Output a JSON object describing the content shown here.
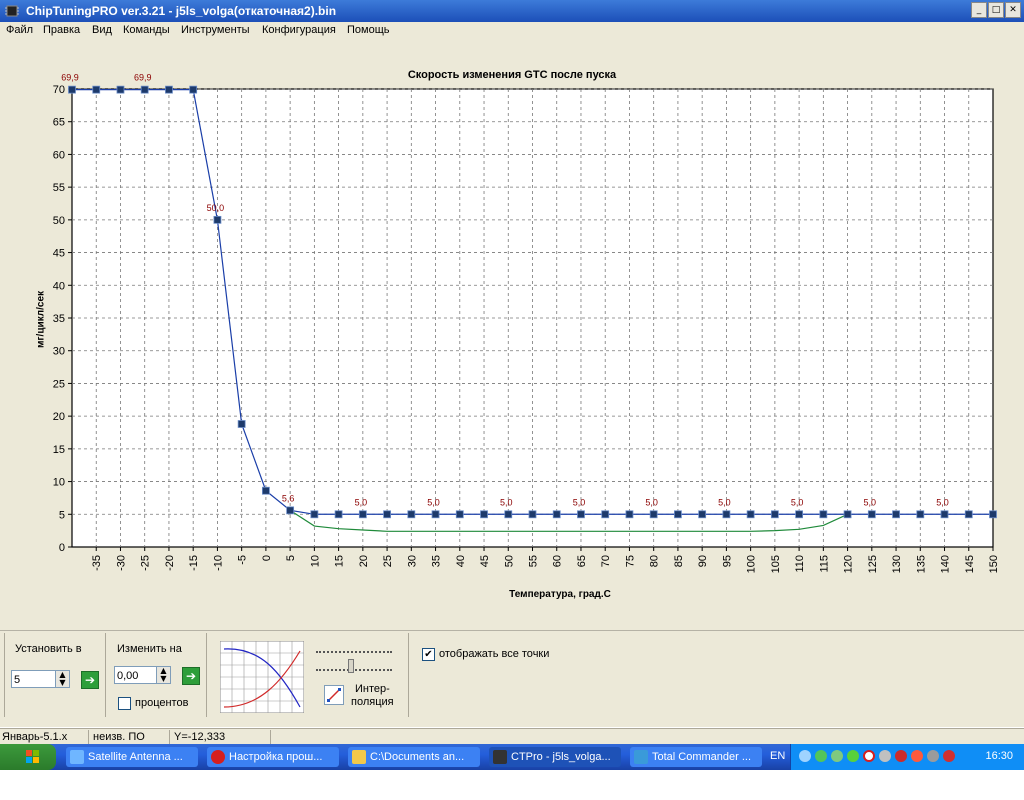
{
  "window": {
    "title": "ChipTuningPRO ver.3.21 - j5ls_volga(откаточная2).bin",
    "buttons": [
      "_",
      "□",
      "✕"
    ]
  },
  "menu": [
    "Файл",
    "Правка",
    "Вид",
    "Команды",
    "Инструменты",
    "Конфигурация",
    "Помощь"
  ],
  "chart_data": {
    "type": "line",
    "title": "Скорость изменения GTC после пуска",
    "xlabel": "Температура, град.С",
    "ylabel": "мг/цикл/сек",
    "xlim": [
      -40,
      150
    ],
    "ylim": [
      0,
      70
    ],
    "x_ticks": [
      -35,
      -30,
      -25,
      -20,
      -15,
      -10,
      -5,
      0,
      5,
      10,
      15,
      20,
      25,
      30,
      35,
      40,
      45,
      50,
      55,
      60,
      65,
      70,
      75,
      80,
      85,
      90,
      95,
      100,
      105,
      110,
      115,
      120,
      125,
      130,
      135,
      140,
      145,
      150
    ],
    "y_ticks": [
      0,
      5,
      10,
      15,
      20,
      25,
      30,
      35,
      40,
      45,
      50,
      55,
      60,
      65,
      70
    ],
    "grid": true,
    "series": [
      {
        "color": "#1a3ea8",
        "markers": true,
        "x": [
          -40,
          -35,
          -30,
          -25,
          -20,
          -15,
          -10,
          -5,
          0,
          5,
          10,
          15,
          20,
          25,
          30,
          35,
          40,
          45,
          50,
          55,
          60,
          65,
          70,
          75,
          80,
          85,
          90,
          95,
          100,
          105,
          110,
          115,
          120,
          125,
          130,
          135,
          140,
          145,
          150
        ],
        "values": [
          69.9,
          69.9,
          69.9,
          69.9,
          69.9,
          69.9,
          50.0,
          18.8,
          8.6,
          5.6,
          5.0,
          5.0,
          5.0,
          5.0,
          5.0,
          5.0,
          5.0,
          5.0,
          5.0,
          5.0,
          5.0,
          5.0,
          5.0,
          5.0,
          5.0,
          5.0,
          5.0,
          5.0,
          5.0,
          5.0,
          5.0,
          5.0,
          5.0,
          5.0,
          5.0,
          5.0,
          5.0,
          5.0,
          5.0
        ]
      },
      {
        "color": "#1f8a3a",
        "markers": false,
        "x": [
          5,
          10,
          15,
          20,
          25,
          30,
          35,
          40,
          45,
          50,
          55,
          60,
          65,
          70,
          75,
          80,
          85,
          90,
          95,
          100,
          105,
          110,
          115,
          120
        ],
        "values": [
          5.6,
          3.2,
          2.8,
          2.6,
          2.4,
          2.4,
          2.4,
          2.4,
          2.4,
          2.4,
          2.4,
          2.4,
          2.4,
          2.4,
          2.4,
          2.4,
          2.4,
          2.4,
          2.4,
          2.4,
          2.5,
          2.7,
          3.3,
          5.0
        ]
      }
    ],
    "point_labels": [
      {
        "x": -40,
        "y": 69.9,
        "text": "69,9"
      },
      {
        "x": -25,
        "y": 69.9,
        "text": "69,9"
      },
      {
        "x": -10,
        "y": 50.0,
        "text": "50,0"
      },
      {
        "x": 5,
        "y": 5.6,
        "text": "5,6"
      },
      {
        "x": 20,
        "y": 5.0,
        "text": "5,0"
      },
      {
        "x": 35,
        "y": 5.0,
        "text": "5,0"
      },
      {
        "x": 50,
        "y": 5.0,
        "text": "5,0"
      },
      {
        "x": 65,
        "y": 5.0,
        "text": "5,0"
      },
      {
        "x": 80,
        "y": 5.0,
        "text": "5,0"
      },
      {
        "x": 95,
        "y": 5.0,
        "text": "5,0"
      },
      {
        "x": 110,
        "y": 5.0,
        "text": "5,0"
      },
      {
        "x": 125,
        "y": 5.0,
        "text": "5,0"
      },
      {
        "x": 140,
        "y": 5.0,
        "text": "5,0"
      }
    ]
  },
  "controls": {
    "set_label": "Установить в",
    "set_value": "5",
    "change_label": "Изменить на",
    "change_value": "0,00",
    "percent_label": "процентов",
    "interp_label_1": "Интер-",
    "interp_label_2": "поляция",
    "show_all_label": "отображать все точки",
    "show_all_checked": "✔"
  },
  "status": {
    "cell1": "Январь-5.1.x",
    "cell2": "неизв. ПО",
    "cell3": "Y=-12,333"
  },
  "taskbar": {
    "tasks": [
      {
        "label": "Satellite Antenna ...",
        "color": "#6fb6ff"
      },
      {
        "label": "Настройка прош...",
        "color": "#d61f1f"
      },
      {
        "label": "C:\\Documents an...",
        "color": "#f2c84b"
      },
      {
        "label": "CTPro - j5ls_volga...",
        "color": "#333333"
      },
      {
        "label": "Total Commander ...",
        "color": "#3a9ad9"
      }
    ],
    "lang": "EN",
    "clock": "16:30"
  }
}
